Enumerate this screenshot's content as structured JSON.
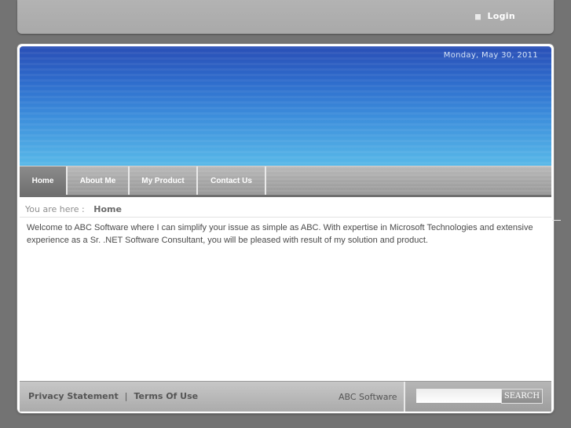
{
  "header": {
    "login_label": "Login"
  },
  "banner": {
    "date": "Monday, May 30, 2011"
  },
  "nav": {
    "items": [
      {
        "label": "Home",
        "active": true
      },
      {
        "label": "About Me",
        "active": false
      },
      {
        "label": "My Product",
        "active": false
      },
      {
        "label": "Contact Us",
        "active": false
      }
    ]
  },
  "breadcrumb": {
    "prefix": "You are here :",
    "current": "Home"
  },
  "content": {
    "text": "Welcome to ABC Software where I can simplify your issue as simple as ABC. With expertise in Microsoft Technologies and extensive experience as a Sr. .NET Software Consultant, you will be pleased with result of my solution and product."
  },
  "footer": {
    "privacy_label": "Privacy Statement",
    "separator": "|",
    "terms_label": "Terms Of Use",
    "brand": "ABC Software",
    "search_placeholder": "",
    "search_button": "SEARCH"
  },
  "colors": {
    "page_bg": "#737373",
    "banner_top": "#2a4fb6",
    "banner_bottom": "#58b8e8",
    "nav_active": "#6f6f6f"
  }
}
